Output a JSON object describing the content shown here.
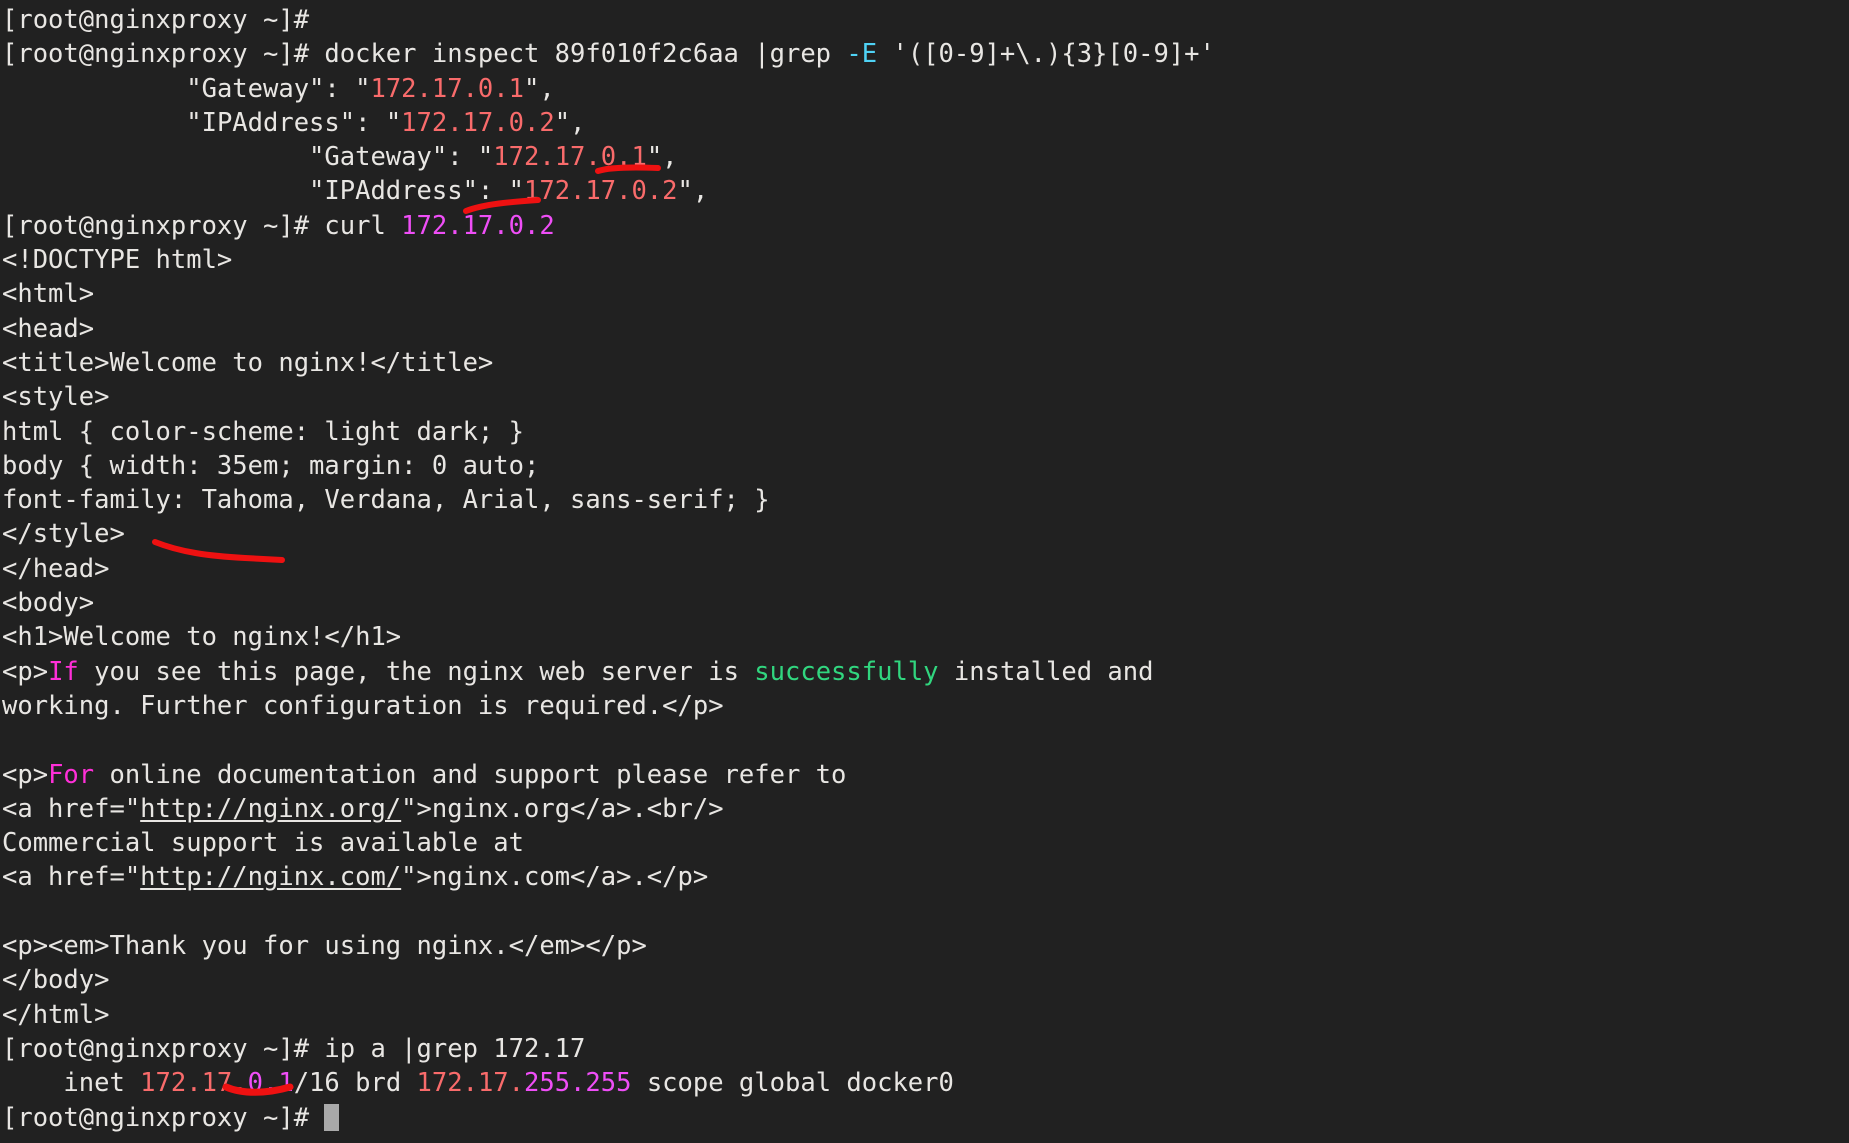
{
  "terminal": {
    "title": "root@nginxproxy terminal",
    "prompt": "[root@nginxproxy ~]#",
    "cursor": "block",
    "colors": {
      "background": "#212121",
      "foreground": "#e8e6e3",
      "grep_match_red": "#f96b6b",
      "magenta": "#ef4ef7",
      "cyan": "#4fd2f5",
      "green": "#31d67f",
      "pink_keyword": "#ff2fd8",
      "annotation_red": "#ee1111",
      "cursor": "#a9a9a9"
    },
    "lines": [
      {
        "id": "l01",
        "prompt": "[root@nginxproxy ~]#",
        "text": ""
      },
      {
        "id": "l02",
        "prompt": "[root@nginxproxy ~]#",
        "cmd_a": " docker inspect 89f010f2c6aa |grep ",
        "cmd_opt": "-E",
        "cmd_b": " '([0-9]+\\.){3}[0-9]+'"
      },
      {
        "id": "l03",
        "indent": "            ",
        "key": "\"Gateway\": \"",
        "ip": "172.17.0.1",
        "tail": "\","
      },
      {
        "id": "l04",
        "indent": "            ",
        "key": "\"IPAddress\": \"",
        "ip": "172.17.0.2",
        "tail": "\","
      },
      {
        "id": "l05",
        "indent": "                    ",
        "key": "\"Gateway\": \"",
        "ip": "172.17.0.1",
        "tail": "\","
      },
      {
        "id": "l06",
        "indent": "                    ",
        "key": "\"IPAddress\": \"",
        "ip": "172.17.0.2",
        "tail": "\","
      },
      {
        "id": "l07",
        "prompt": "[root@nginxproxy ~]#",
        "cmd_a": " curl ",
        "arg": "172.17.0.2"
      },
      {
        "id": "l08",
        "text": "<!DOCTYPE html>"
      },
      {
        "id": "l09",
        "text": "<html>"
      },
      {
        "id": "l10",
        "text": "<head>"
      },
      {
        "id": "l11",
        "text": "<title>Welcome to nginx!</title>"
      },
      {
        "id": "l12",
        "text": "<style>"
      },
      {
        "id": "l13",
        "text": "html { color-scheme: light dark; }"
      },
      {
        "id": "l14",
        "text": "body { width: 35em; margin: 0 auto;"
      },
      {
        "id": "l15",
        "text": "font-family: Tahoma, Verdana, Arial, sans-serif; }"
      },
      {
        "id": "l16",
        "text": "</style>"
      },
      {
        "id": "l17",
        "text": "</head>"
      },
      {
        "id": "l18",
        "text": "<body>"
      },
      {
        "id": "l19",
        "text": "<h1>Welcome to nginx!</h1>"
      },
      {
        "id": "l20",
        "pre": "<p>",
        "kw": "If",
        "post": " you see this page, the nginx web server is ",
        "ok": "successfully",
        "post2": " installed and"
      },
      {
        "id": "l21",
        "text": "working. Further configuration is required.</p>"
      },
      {
        "id": "l22",
        "text": ""
      },
      {
        "id": "l23",
        "pre": "<p>",
        "kw": "For",
        "post": " online documentation and support please refer to"
      },
      {
        "id": "l24",
        "pre": "<a href=\"",
        "url": "http://nginx.org/",
        "post": "\">nginx.org</a>.<br/>"
      },
      {
        "id": "l25",
        "text": "Commercial support is available at"
      },
      {
        "id": "l26",
        "pre": "<a href=\"",
        "url": "http://nginx.com/",
        "post": "\">nginx.com</a>.</p>"
      },
      {
        "id": "l27",
        "text": ""
      },
      {
        "id": "l28",
        "text": "<p><em>Thank you for using nginx.</em></p>"
      },
      {
        "id": "l29",
        "text": "</body>"
      },
      {
        "id": "l30",
        "text": "</html>"
      },
      {
        "id": "l31",
        "prompt": "[root@nginxproxy ~]#",
        "cmd_a": " ip a |grep 172.17"
      },
      {
        "id": "l32",
        "indent": "    inet ",
        "ip_match": "172.17.",
        "ip_rest": "0.1",
        "mid": "/16 brd ",
        "ip2_match": "172.17.",
        "ip2_rest": "255.255",
        "tail": " scope global docker0"
      },
      {
        "id": "l33",
        "prompt": "[root@nginxproxy ~]#",
        "cmd_a": " "
      }
    ],
    "annotations": [
      {
        "id": "a1",
        "name": "underline-ipaddress-172-17-0-2",
        "desc": "red underline under 172.17.0.2 in IPAddress output"
      },
      {
        "id": "a2",
        "name": "underline-curl-target-ip",
        "desc": "red underline under curl 172.17.0.2 argument"
      },
      {
        "id": "a3",
        "name": "strike-welcome-to-nginx",
        "desc": "red slanted stroke across 'Welcome to' / 'this'"
      },
      {
        "id": "a4",
        "name": "underline-docker0-gateway-ip",
        "desc": "red underline under 0.1 of inet 172.17.0.1"
      }
    ]
  }
}
